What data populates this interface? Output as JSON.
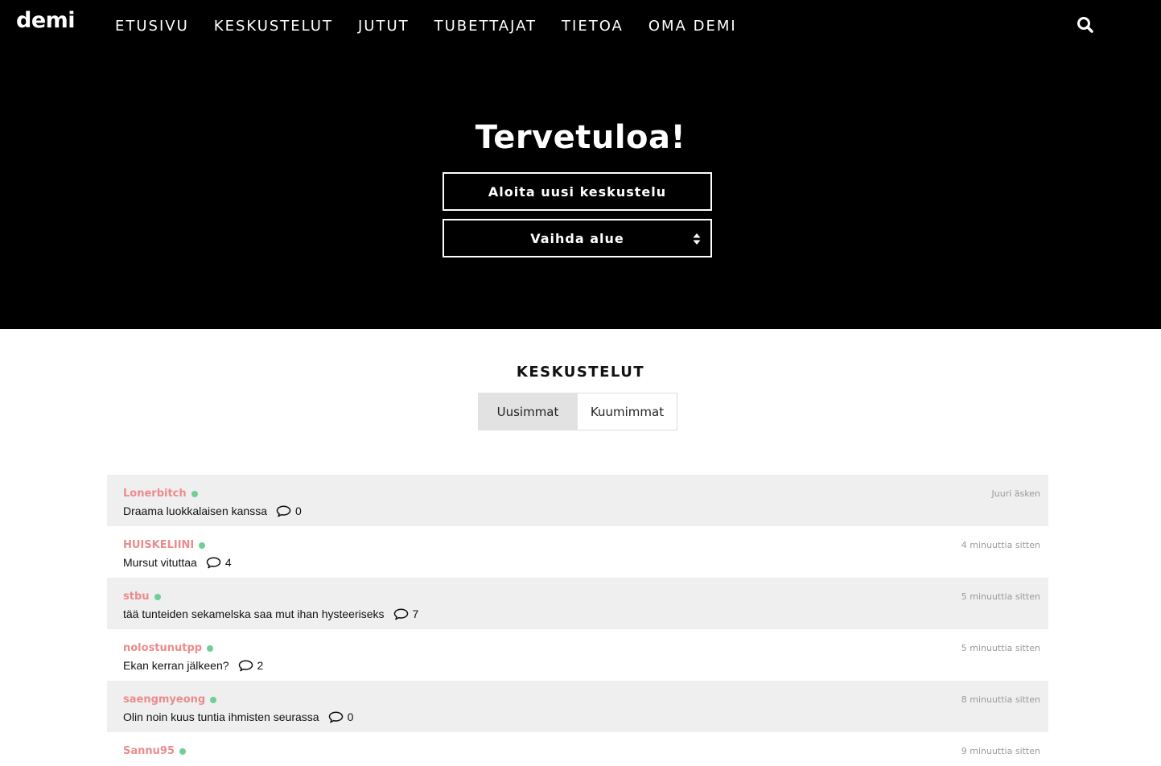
{
  "header": {
    "logo": "demi",
    "nav": [
      "ETUSIVU",
      "KESKUSTELUT",
      "JUTUT",
      "TUBETTAJAT",
      "TIETOA",
      "OMA DEMI"
    ]
  },
  "hero": {
    "title": "Tervetuloa!",
    "start_button": "Aloita uusi keskustelu",
    "area_select": "Vaihda alue"
  },
  "section": {
    "title": "KESKUSTELUT",
    "tabs": [
      "Uusimmat",
      "Kuumimmat"
    ],
    "active_tab": "Uusimmat"
  },
  "threads": [
    {
      "user": "Lonerbitch",
      "subject": "Draama luokkalaisen kanssa",
      "comments": "0",
      "time": "Juuri äsken"
    },
    {
      "user": "HUISKELIINI",
      "subject": "Mursut vituttaa",
      "comments": "4",
      "time": "4 minuuttia sitten"
    },
    {
      "user": "stbu",
      "subject": "tää tunteiden sekamelska saa mut ihan hysteeriseks",
      "comments": "7",
      "time": "5 minuuttia sitten"
    },
    {
      "user": "nolostunutpp",
      "subject": "Ekan kerran jälkeen?",
      "comments": "2",
      "time": "5 minuuttia sitten"
    },
    {
      "user": "saengmyeong",
      "subject": "Olin noin kuus tuntia ihmisten seurassa",
      "comments": "0",
      "time": "8 minuuttia sitten"
    },
    {
      "user": "Sannu95",
      "subject": "",
      "comments": "",
      "time": "9 minuuttia sitten"
    }
  ],
  "colors": {
    "header_bg": "#000000",
    "username": "#eb8c8c",
    "online": "#6fcf97",
    "row_shade": "#efefef"
  }
}
